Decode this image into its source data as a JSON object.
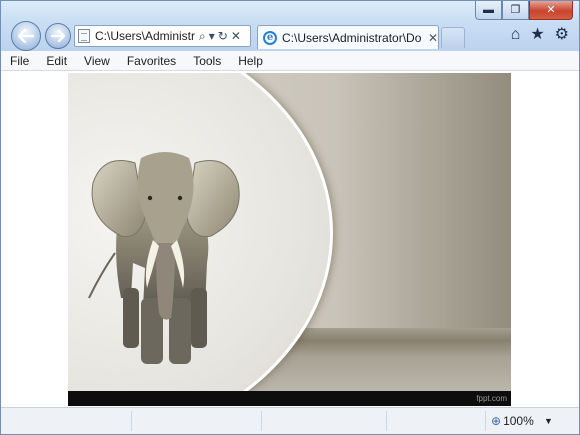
{
  "window": {
    "caption_buttons": {
      "minimize": "▬",
      "maximize": "❐",
      "close": "✕"
    }
  },
  "navigation": {
    "back_icon": "back-arrow-icon",
    "forward_icon": "forward-arrow-icon",
    "address": {
      "value": "C:\\Users\\Administr",
      "search_glyph": "⌕",
      "dropdown_glyph": "▾",
      "refresh_glyph": "↻",
      "stop_glyph": "✕"
    },
    "tab": {
      "title": "C:\\Users\\Administrator\\Do...",
      "ie_glyph": "e",
      "close_glyph": "✕"
    },
    "command_icons": {
      "home": "⌂",
      "favorites": "★",
      "tools": "⚙"
    }
  },
  "menu": {
    "items": [
      "File",
      "Edit",
      "View",
      "Favorites",
      "Tools",
      "Help"
    ]
  },
  "content": {
    "watermark": "fppt.com",
    "colors": {
      "footer": "#0d0d0d",
      "circle_border": "#ffffff"
    }
  },
  "status_bar": {
    "zoom_label": "100%",
    "zoom_glyph": "⊕",
    "dropdown_glyph": "▼"
  }
}
